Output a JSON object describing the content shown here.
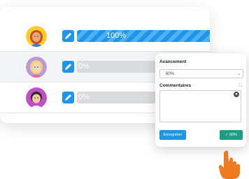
{
  "rows": [
    {
      "progress_label": "100%",
      "progress_value": 1.0
    },
    {
      "progress_label": "0%",
      "progress_value": 0
    },
    {
      "progress_label": "0%",
      "progress_value": 0
    }
  ],
  "edit_panel": {
    "progress_label": "Avancement",
    "progress_selected": "60%",
    "comments_label": "Commentaires",
    "comments_value": "",
    "save_label": "Enregistrer",
    "validate_label": "60%"
  },
  "colors": {
    "accent_blue": "#1b96e8",
    "accent_green": "#1d9e84",
    "hand_orange": "#f07a1f"
  },
  "icons": [
    "pencil-icon",
    "chevron-down-icon",
    "expand-icon",
    "info-icon",
    "check-circle-icon",
    "pointing-hand-icon"
  ]
}
